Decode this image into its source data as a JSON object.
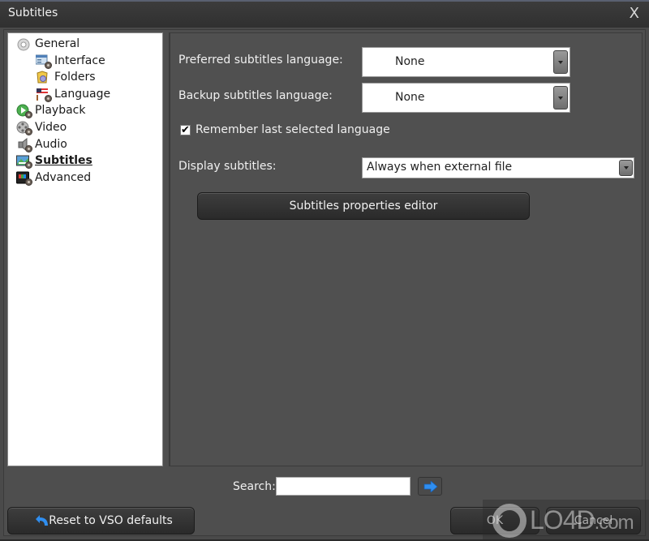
{
  "window": {
    "title": "Subtitles",
    "close_label": "X"
  },
  "tree": {
    "items": [
      {
        "label": "General",
        "level": 0,
        "icon": "gear-icon"
      },
      {
        "label": "Interface",
        "level": 1,
        "icon": "interface-icon"
      },
      {
        "label": "Folders",
        "level": 1,
        "icon": "folder-icon"
      },
      {
        "label": "Language",
        "level": 1,
        "icon": "flag-icon"
      },
      {
        "label": "Playback",
        "level": 0,
        "icon": "play-icon"
      },
      {
        "label": "Video",
        "level": 0,
        "icon": "film-reel-icon"
      },
      {
        "label": "Audio",
        "level": 0,
        "icon": "speaker-icon"
      },
      {
        "label": "Subtitles",
        "level": 0,
        "icon": "subtitles-icon",
        "selected": true
      },
      {
        "label": "Advanced",
        "level": 0,
        "icon": "monitor-icon"
      }
    ]
  },
  "panel": {
    "preferred_label": "Preferred subtitles language:",
    "preferred_value": "None",
    "backup_label": "Backup subtitles language:",
    "backup_value": "None",
    "remember_label": "Remember last selected language",
    "remember_checked": true,
    "remember_mark": "✔",
    "display_label": "Display subtitles:",
    "display_value": "Always when external file",
    "editor_button": "Subtitles properties editor"
  },
  "footer": {
    "search_label": "Search:",
    "search_value": "",
    "reset_button": "Reset to VSO defaults",
    "ok_button": "OK",
    "cancel_button": "Cancel"
  },
  "watermark": {
    "text": "LO4D",
    "suffix": ".com"
  },
  "colors": {
    "accent_arrow": "#2f8ef0",
    "panel_bg": "#505050",
    "window_bg": "#4a4a4a"
  }
}
